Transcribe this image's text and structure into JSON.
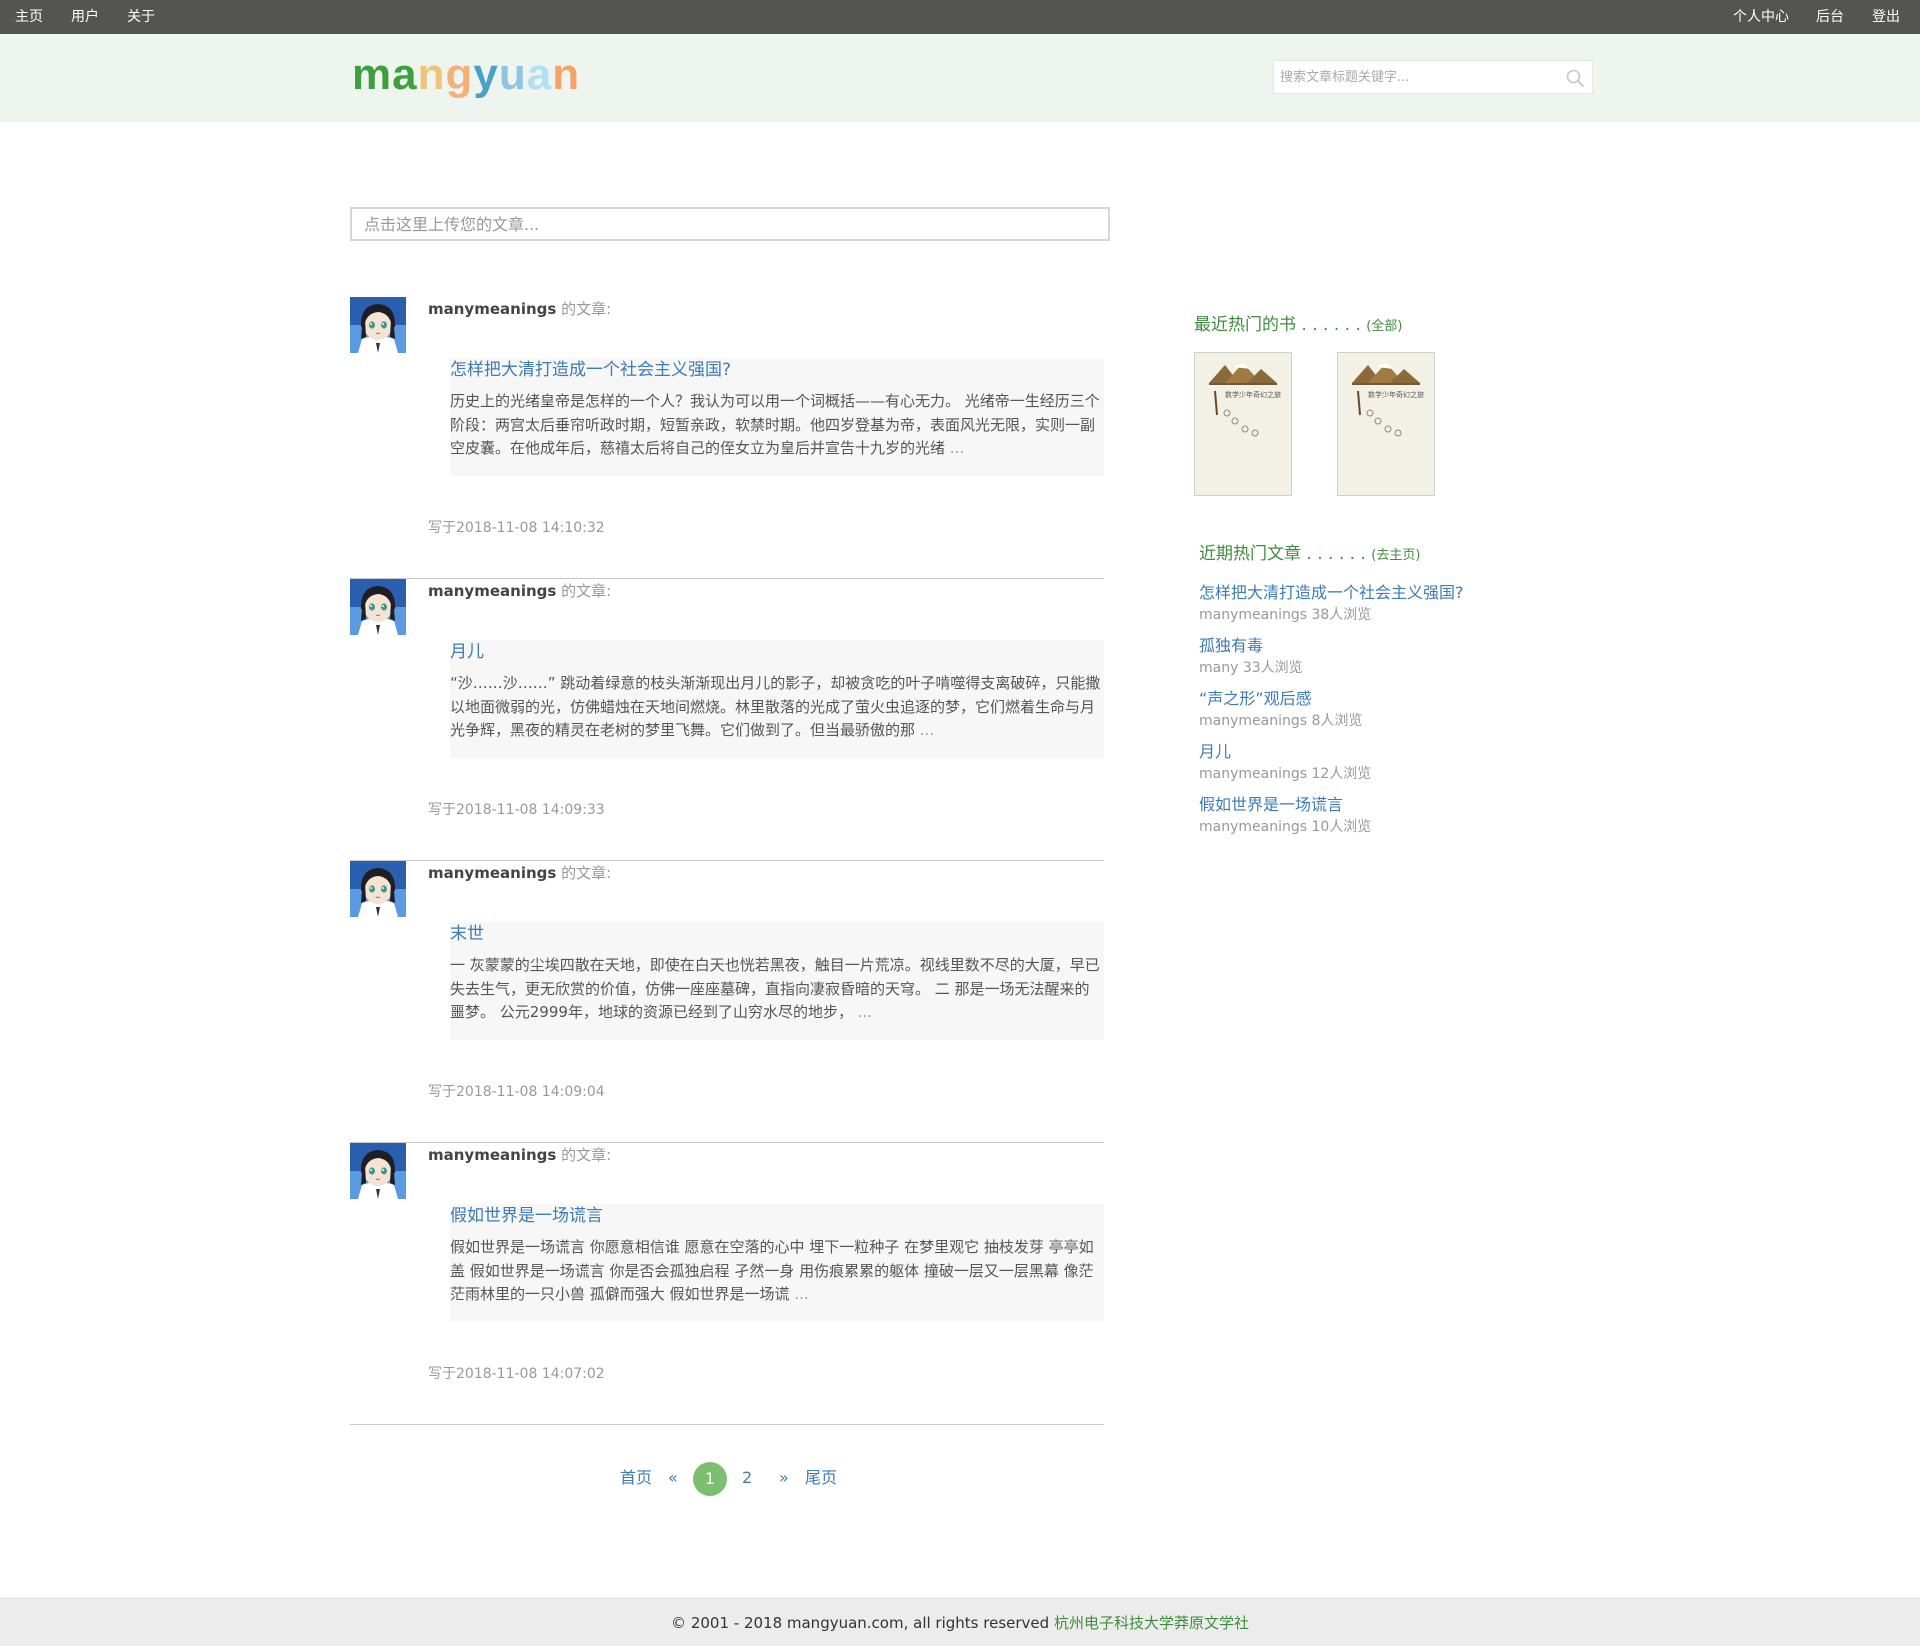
{
  "topnav": {
    "left": [
      "主页",
      "用户",
      "关于"
    ],
    "right": [
      "个人中心",
      "后台",
      "登出"
    ]
  },
  "header": {
    "logo_letters": [
      {
        "ch": "m",
        "color": "#3f9f3f"
      },
      {
        "ch": "a",
        "color": "#3f9f3f"
      },
      {
        "ch": "n",
        "color": "#f0c27a"
      },
      {
        "ch": "g",
        "color": "#f0b27a"
      },
      {
        "ch": "y",
        "color": "#4aa0c8"
      },
      {
        "ch": "u",
        "color": "#8fc4e2"
      },
      {
        "ch": "a",
        "color": "#b3e0f0"
      },
      {
        "ch": "n",
        "color": "#f4a46a"
      }
    ],
    "search_placeholder": "搜索文章标题关键字..."
  },
  "upload_placeholder": "点击这里上传您的文章...",
  "articles": [
    {
      "author": "manymeanings",
      "author_suffix": "的文章:",
      "title": "怎样把大清打造成一个社会主义强国?",
      "excerpt": "历史上的光绪皇帝是怎样的一个人？我认为可以用一个词概括——有心无力。 光绪帝一生经历三个阶段：两宫太后垂帘听政时期，短暂亲政，软禁时期。他四岁登基为帝，表面风光无限，实则一副空皮囊。在他成年后，慈禧太后将自己的侄女立为皇后并宣告十九岁的光绪",
      "more": " ...",
      "time": "写于2018-11-08 14:10:32"
    },
    {
      "author": "manymeanings",
      "author_suffix": "的文章:",
      "title": "月儿",
      "excerpt": "“沙……沙……” 跳动着绿意的枝头渐渐现出月儿的影子，却被贪吃的叶子啃噬得支离破碎，只能撒以地面微弱的光，仿佛蜡烛在天地间燃烧。林里散落的光成了萤火虫追逐的梦，它们燃着生命与月光争辉，黑夜的精灵在老树的梦里飞舞。它们做到了。但当最骄傲的那",
      "more": " ...",
      "time": "写于2018-11-08 14:09:33"
    },
    {
      "author": "manymeanings",
      "author_suffix": "的文章:",
      "title": "末世",
      "excerpt": "一 灰蒙蒙的尘埃四散在天地，即使在白天也恍若黑夜，触目一片荒凉。视线里数不尽的大厦，早已失去生气，更无欣赏的价值，仿佛一座座墓碑，直指向凄寂昏暗的天穹。 二 那是一场无法醒来的噩梦。 公元2999年，地球的资源已经到了山穷水尽的地步，",
      "more": " ...",
      "time": "写于2018-11-08 14:09:04"
    },
    {
      "author": "manymeanings",
      "author_suffix": "的文章:",
      "title": "假如世界是一场谎言",
      "excerpt": "假如世界是一场谎言 你愿意相信谁 愿意在空落的心中 埋下一粒种子 在梦里观它 抽枝发芽 亭亭如盖 假如世界是一场谎言 你是否会孤独启程 孑然一身 用伤痕累累的躯体 撞破一层又一层黑幕 像茫茫雨林里的一只小兽 孤僻而强大 假如世界是一场谎",
      "more": " ...",
      "time": "写于2018-11-08 14:07:02"
    }
  ],
  "pagination": {
    "first": "首页",
    "prev": "«",
    "current": "1",
    "page2": "2",
    "next": "»",
    "last": "尾页"
  },
  "sidebar": {
    "books_heading": "最近热门的书 . . . . . .",
    "books_link": "(全部)",
    "book_cover_text": "数学少年奇幻之旅",
    "articles_heading": "近期热门文章 . . . . . .",
    "articles_link": "(去主页)",
    "hot_articles": [
      {
        "title": "怎样把大清打造成一个社会主义强国?",
        "meta": "manymeanings 38人浏览"
      },
      {
        "title": "孤独有毒",
        "meta": "many 33人浏览"
      },
      {
        "title": "“声之形”观后感",
        "meta": "manymeanings 8人浏览"
      },
      {
        "title": "月儿",
        "meta": "manymeanings 12人浏览"
      },
      {
        "title": "假如世界是一场谎言",
        "meta": "manymeanings 10人浏览"
      }
    ]
  },
  "footer": {
    "copyright": "© 2001 - 2018 mangyuan.com, all rights reserved ",
    "org": "杭州电子科技大学莽原文学社"
  },
  "colors": {
    "topnav_bg": "#545450",
    "header_bg": "#eef4ee",
    "link_blue": "#3d7bb6",
    "accent_green": "#3f8c3f",
    "pager_active": "#7cbf70"
  }
}
